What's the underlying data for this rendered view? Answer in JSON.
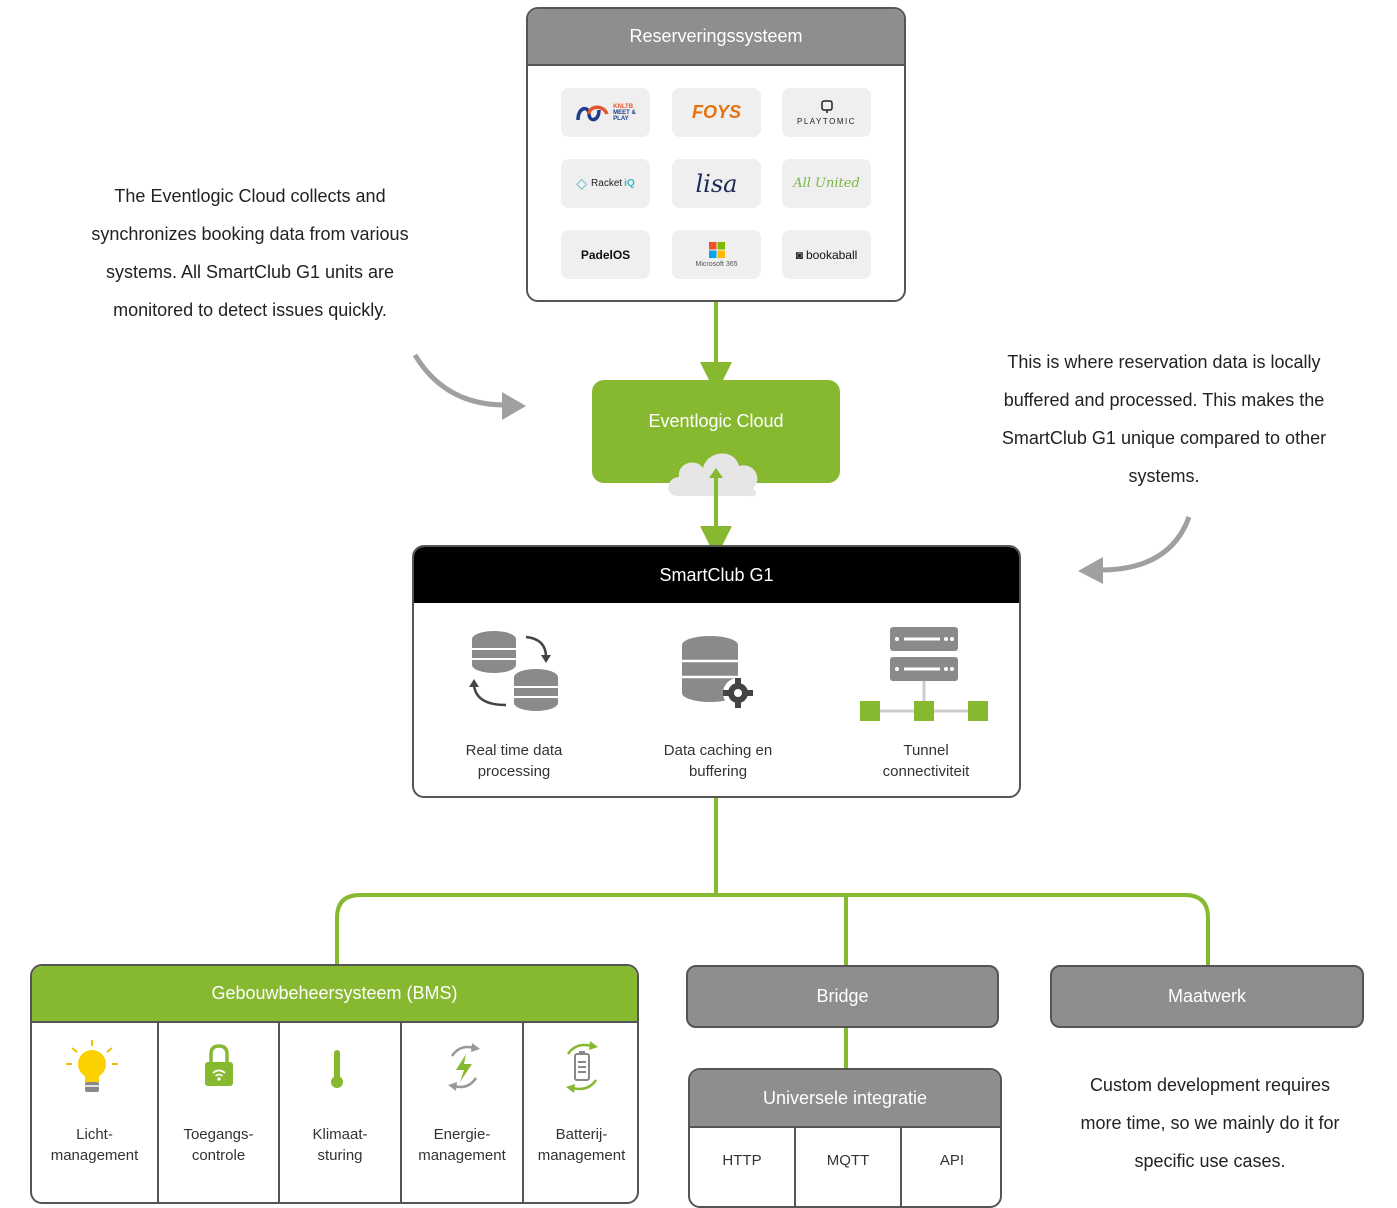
{
  "reservation": {
    "title": "Reserveringssysteem",
    "logos": [
      {
        "name": "knltb",
        "line1": "KNLTB",
        "line2": "MEET &",
        "line3": "PLAY"
      },
      {
        "name": "foys",
        "text": "FOYS"
      },
      {
        "name": "playtomic",
        "text": "PLAYTOMIC"
      },
      {
        "name": "racketiq",
        "text": "Racket",
        "accent": "iQ"
      },
      {
        "name": "lisa",
        "text": "lisa"
      },
      {
        "name": "allunited",
        "text": "All United"
      },
      {
        "name": "padelos",
        "text": "PadelOS"
      },
      {
        "name": "microsoft365",
        "text": "Microsoft 365"
      },
      {
        "name": "bookaball",
        "text": "bookaball"
      }
    ]
  },
  "notes": {
    "left": [
      "The Eventlogic Cloud collects and",
      "synchronizes booking data from various",
      "systems. All SmartClub G1 units are",
      "monitored to detect issues quickly."
    ],
    "right": [
      "This is where reservation data is locally",
      "buffered and processed. This makes the",
      "SmartClub G1 unique compared to other",
      "systems."
    ],
    "bottom": [
      "Custom development requires",
      "more time, so we mainly do it for",
      "specific use cases."
    ]
  },
  "cloud": {
    "title": "Eventlogic Cloud"
  },
  "smartclub": {
    "title": "SmartClub G1",
    "features": [
      {
        "line1": "Real time data",
        "line2": "processing"
      },
      {
        "line1": "Data caching en",
        "line2": "buffering"
      },
      {
        "line1": "Tunnel",
        "line2": "connectiviteit"
      }
    ]
  },
  "bms": {
    "title": "Gebouwbeheersysteem (BMS)",
    "items": [
      {
        "line1": "Licht-",
        "line2": "management"
      },
      {
        "line1": "Toegangs-",
        "line2": "controle"
      },
      {
        "line1": "Klimaat-",
        "line2": "sturing"
      },
      {
        "line1": "Energie-",
        "line2": "management"
      },
      {
        "line1": "Batterij-",
        "line2": "management"
      }
    ]
  },
  "bridge": {
    "title": "Bridge"
  },
  "maatwerk": {
    "title": "Maatwerk"
  },
  "integration": {
    "title": "Universele integratie",
    "protocols": [
      "HTTP",
      "MQTT",
      "API"
    ]
  },
  "colors": {
    "green": "#86b830",
    "gray": "#8e8e8e",
    "black": "#000000",
    "arrow": "#a0a0a0"
  }
}
